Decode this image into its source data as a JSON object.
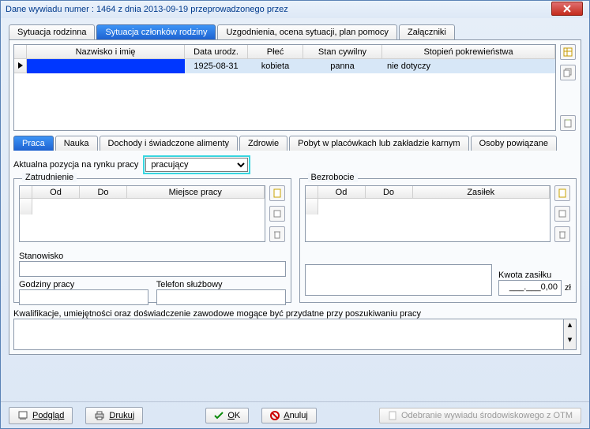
{
  "window": {
    "title": "Dane wywiadu numer : 1464 z dnia 2013-09-19 przeprowadzonego przez"
  },
  "main_tabs": [
    {
      "label": "Sytuacja rodzinna"
    },
    {
      "label": "Sytuacja członków rodziny",
      "active": true
    },
    {
      "label": "Uzgodnienia, ocena sytuacji, plan pomocy"
    },
    {
      "label": "Załączniki"
    }
  ],
  "members_grid": {
    "headers": {
      "name": "Nazwisko i imię",
      "dob": "Data urodz.",
      "sex": "Płeć",
      "marital": "Stan cywilny",
      "kinship": "Stopień pokrewieństwa"
    },
    "row": {
      "name": "",
      "dob": "1925-08-31",
      "sex": "kobieta",
      "marital": "panna",
      "kinship": "nie dotyczy"
    }
  },
  "inner_tabs": [
    {
      "label": "Praca",
      "active": true
    },
    {
      "label": "Nauka"
    },
    {
      "label": "Dochody i świadczone alimenty"
    },
    {
      "label": "Zdrowie"
    },
    {
      "label": "Pobyt w placówkach lub zakładzie karnym"
    },
    {
      "label": "Osoby powiązane"
    }
  ],
  "labor": {
    "label": "Aktualna pozycja na rynku pracy",
    "value": "pracujący"
  },
  "employment": {
    "title": "Zatrudnienie",
    "headers": {
      "from": "Od",
      "to": "Do",
      "place": "Miejsce pracy"
    },
    "position_label": "Stanowisko",
    "hours_label": "Godziny pracy",
    "phone_label": "Telefon służbowy"
  },
  "unemployment": {
    "title": "Bezrobocie",
    "headers": {
      "from": "Od",
      "to": "Do",
      "benefit": "Zasiłek"
    },
    "amount_label": "Kwota zasiłku",
    "amount_value": "___.___0,00",
    "amount_unit": "zł"
  },
  "qual": {
    "label": "Kwalifikacje, umiejętności oraz doświadczenie zawodowe mogące być przydatne przy poszukiwaniu pracy"
  },
  "footer": {
    "preview": "Podgląd",
    "print": "Drukuj",
    "ok": "OK",
    "cancel": "Anuluj",
    "receive": "Odebranie wywiadu środowiskowego z OTM"
  }
}
